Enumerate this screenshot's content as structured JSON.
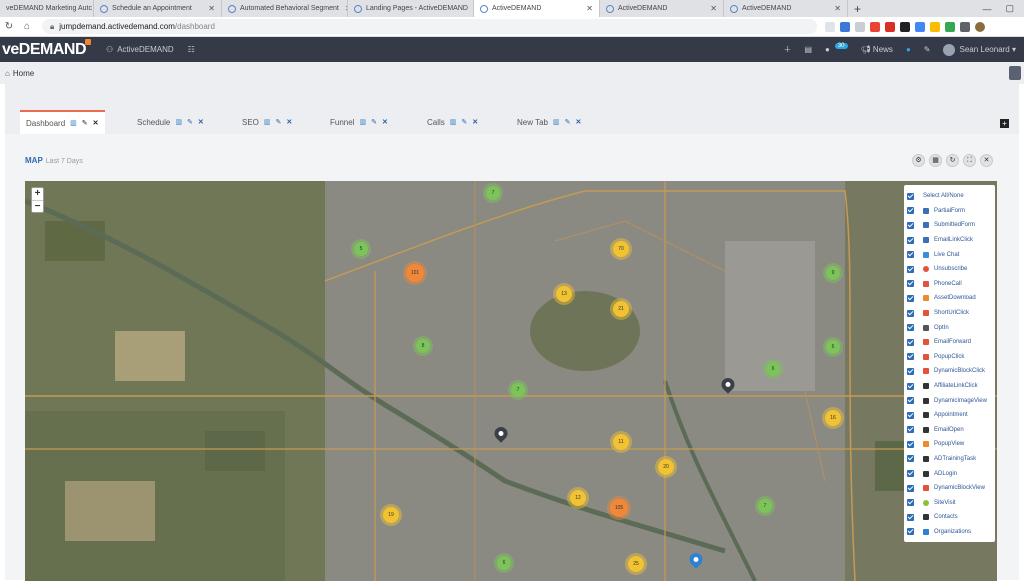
{
  "browser": {
    "tabs": [
      {
        "title": "veDEMAND Marketing Autc"
      },
      {
        "title": "Schedule an Appointment"
      },
      {
        "title": "Automated Behavioral Segment"
      },
      {
        "title": "Landing Pages - ActiveDEMAND"
      },
      {
        "title": "ActiveDEMAND"
      },
      {
        "title": "ActiveDEMAND"
      },
      {
        "title": "ActiveDEMAND"
      }
    ],
    "new_tab": "+",
    "url_host": "jumpdemand.activedemand.com",
    "url_path": "/dashboard"
  },
  "header": {
    "logo_text": "veDEMAND",
    "brand_label": "ActiveDEMAND",
    "notif_count": "30",
    "news_label": "News",
    "user_name": "Sean Leonard"
  },
  "breadcrumb": {
    "home_label": "Home"
  },
  "dash_tabs": [
    {
      "label": "Dashboard",
      "active": true
    },
    {
      "label": "Schedule",
      "active": false
    },
    {
      "label": "SEO",
      "active": false
    },
    {
      "label": "Funnel",
      "active": false
    },
    {
      "label": "Calls",
      "active": false
    },
    {
      "label": "New Tab",
      "active": false
    }
  ],
  "widget": {
    "title": "MAP",
    "subtitle": "Last 7 Days"
  },
  "map": {
    "zoom_in": "+",
    "zoom_out": "−",
    "clusters": [
      {
        "value": "7",
        "color": "green"
      },
      {
        "value": "5",
        "color": "green"
      },
      {
        "value": "70",
        "color": "yellow"
      },
      {
        "value": "101",
        "color": "orange"
      },
      {
        "value": "13",
        "color": "yellow"
      },
      {
        "value": "21",
        "color": "yellow"
      },
      {
        "value": "9",
        "color": "green"
      },
      {
        "value": "8",
        "color": "green"
      },
      {
        "value": "6",
        "color": "green"
      },
      {
        "value": "6",
        "color": "green"
      },
      {
        "value": "7",
        "color": "green"
      },
      {
        "value": "16",
        "color": "yellow"
      },
      {
        "value": "11",
        "color": "yellow"
      },
      {
        "value": "20",
        "color": "yellow"
      },
      {
        "value": "12",
        "color": "yellow"
      },
      {
        "value": "105",
        "color": "orange"
      },
      {
        "value": "19",
        "color": "yellow"
      },
      {
        "value": "7",
        "color": "green"
      },
      {
        "value": "6",
        "color": "green"
      },
      {
        "value": "25",
        "color": "yellow"
      }
    ]
  },
  "legend": {
    "items": [
      {
        "label": "Select All/None",
        "icon_color": ""
      },
      {
        "label": "PartialForm",
        "icon_color": "#3b6fb6"
      },
      {
        "label": "SubmittedForm",
        "icon_color": "#3b6fb6"
      },
      {
        "label": "EmailLinkClick",
        "icon_color": "#3b6fb6"
      },
      {
        "label": "Live Chat",
        "icon_color": "#3b8fd9"
      },
      {
        "label": "Unsubscribe",
        "icon_color": "#e2523c"
      },
      {
        "label": "PhoneCall",
        "icon_color": "#e2523c"
      },
      {
        "label": "AssetDownload",
        "icon_color": "#f08a2e"
      },
      {
        "label": "ShortUrlClick",
        "icon_color": "#e2523c"
      },
      {
        "label": "OptIn",
        "icon_color": "#555555"
      },
      {
        "label": "EmailForward",
        "icon_color": "#e2523c"
      },
      {
        "label": "PopupClick",
        "icon_color": "#e2523c"
      },
      {
        "label": "DynamicBlockClick",
        "icon_color": "#e2523c"
      },
      {
        "label": "AffiliateLinkClick",
        "icon_color": "#333333"
      },
      {
        "label": "DynamicImageView",
        "icon_color": "#333333"
      },
      {
        "label": "Appointment",
        "icon_color": "#333333"
      },
      {
        "label": "EmailOpen",
        "icon_color": "#333333"
      },
      {
        "label": "PopupView",
        "icon_color": "#f08a2e"
      },
      {
        "label": "ADTrainingTask",
        "icon_color": "#333333"
      },
      {
        "label": "ADLogin",
        "icon_color": "#333333"
      },
      {
        "label": "DynamicBlockView",
        "icon_color": "#e2523c"
      },
      {
        "label": "SiteVisit",
        "icon_color": "#8bbf3c"
      },
      {
        "label": "Contacts",
        "icon_color": "#333333"
      },
      {
        "label": "Organizations",
        "icon_color": "#2f80d1"
      }
    ]
  }
}
